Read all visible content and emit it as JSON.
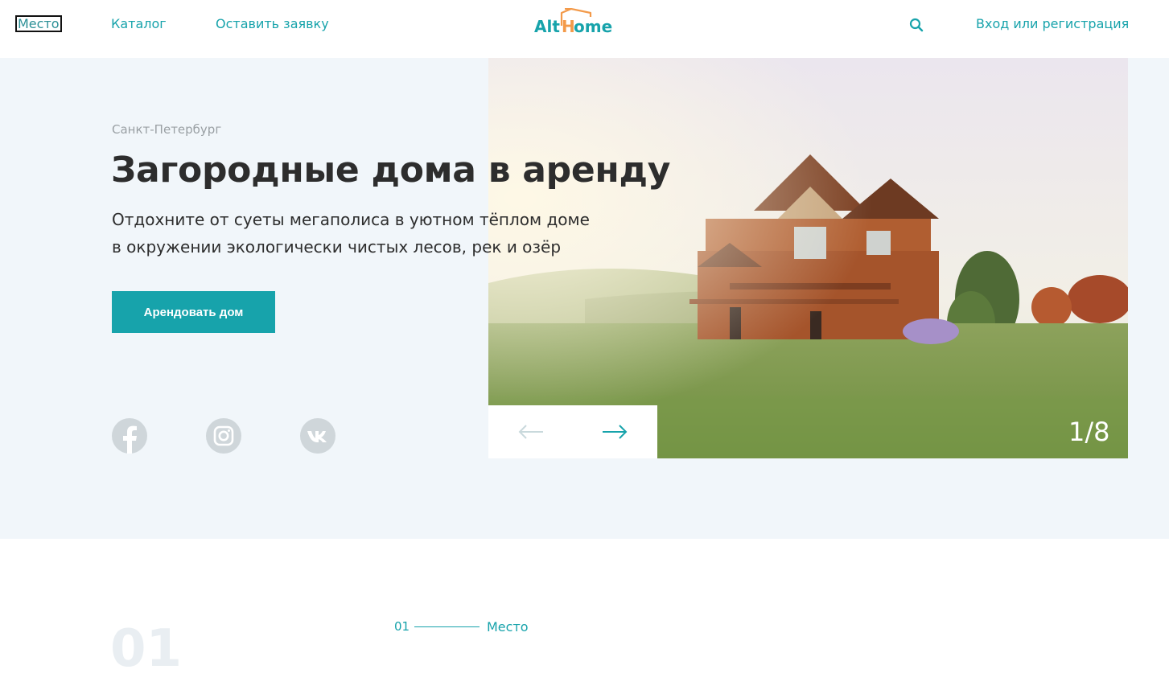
{
  "header": {
    "nav": [
      {
        "label": "Место"
      },
      {
        "label": "Каталог"
      },
      {
        "label": "Оставить заявку"
      }
    ],
    "logo_text": "AltHome",
    "login_label": "Вход или регистрация"
  },
  "hero": {
    "city": "Санкт-Петербург",
    "title": "Загородные дома в аренду",
    "subtitle_line1": "Отдохните от суеты мегаполиса в уютном тёплом доме",
    "subtitle_line2": "в окружении экологически чистых лесов, рек и озёр",
    "button_label": "Арендовать дом",
    "slide_counter": "1/8",
    "social": [
      "facebook-icon",
      "instagram-icon",
      "vk-icon"
    ]
  },
  "section": {
    "big_number": "01",
    "label_number": "01",
    "label": "Место"
  },
  "colors": {
    "accent": "#17a3ab",
    "logo_orange": "#f39a4a",
    "hero_bg": "#f1f6fa"
  }
}
